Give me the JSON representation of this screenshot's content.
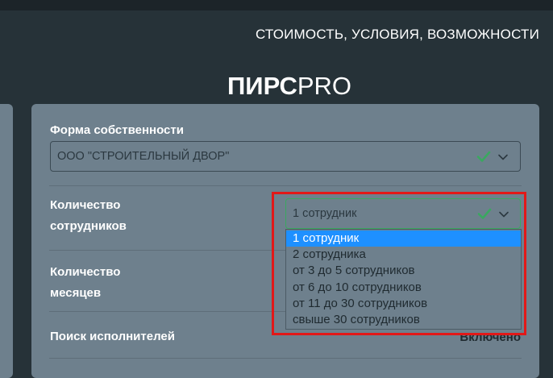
{
  "header": {
    "nav_title": "СТОИМОСТЬ, УСЛОВИЯ, ВОЗМОЖНОСТИ",
    "logo_bold": "ПИРС",
    "logo_light": "PRO"
  },
  "form": {
    "ownership": {
      "label": "Форма собственности",
      "value": "ООО \"СТРОИТЕЛЬНЫЙ ДВОР\""
    },
    "employees": {
      "label_line1": "Количество",
      "label_line2": "сотрудников",
      "value": "1 сотрудник",
      "options": [
        "1 сотрудник",
        "2 сотрудника",
        "от 3 до 5 сотрудников",
        "от 6 до 10 сотрудников",
        "от 11 до 30 сотрудников",
        "свыше 30 сотрудников"
      ],
      "selected_index": 0
    },
    "months": {
      "label_line1": "Количество",
      "label_line2": "месяцев"
    },
    "search": {
      "label": "Поиск исполнителей",
      "value": "Включено"
    }
  },
  "colors": {
    "background": "#263238",
    "card": "#6e808d",
    "accent_check": "#3aa860",
    "selected_option": "#1e90ff",
    "highlight_box": "#e21818"
  }
}
